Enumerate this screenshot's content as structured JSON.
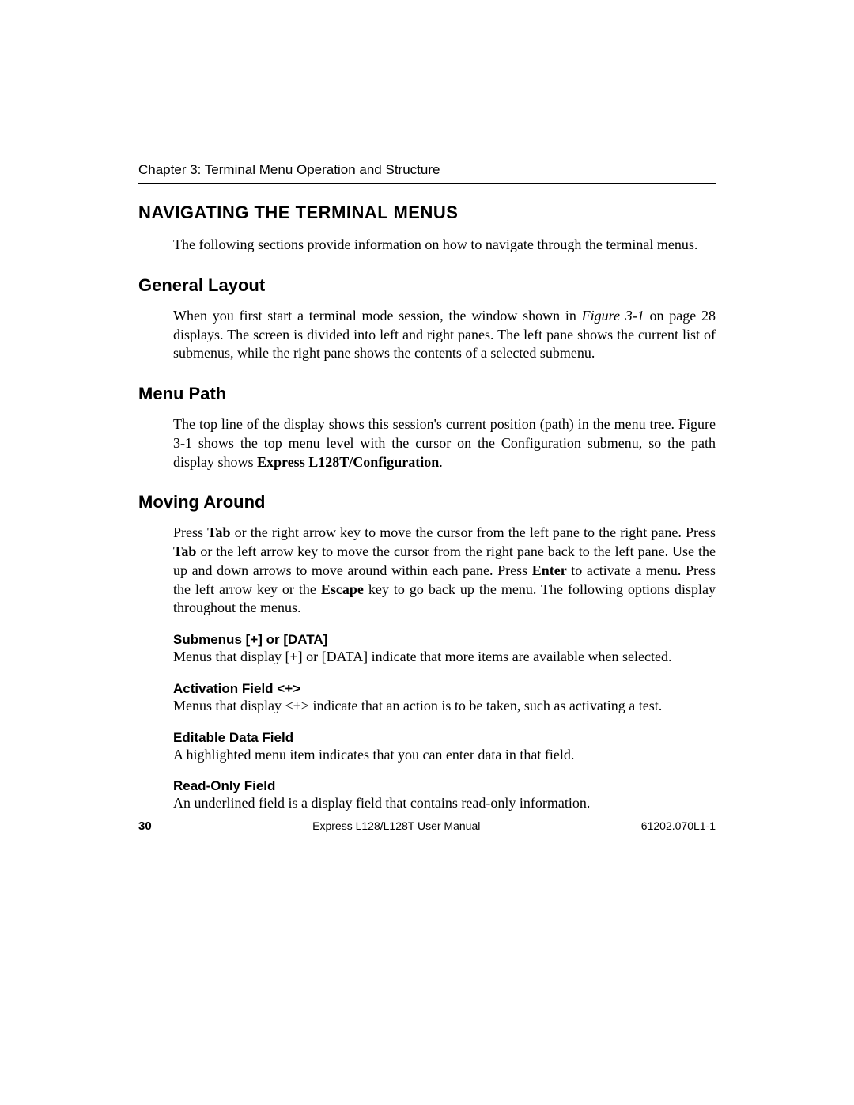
{
  "header": {
    "chapter": "Chapter 3: Terminal Menu Operation and Structure"
  },
  "title": "NAVIGATING THE TERMINAL MENUS",
  "intro": "The following sections provide information on how to navigate through the terminal menus.",
  "sections": {
    "general_layout": {
      "heading": "General Layout",
      "pre": "When you first start a terminal mode session, the window shown in ",
      "figref": "Figure 3-1",
      "post": " on page 28 displays. The screen is divided into left and right panes.  The left pane shows the current list of submenus, while the right pane shows the contents of a selected submenu."
    },
    "menu_path": {
      "heading": "Menu Path",
      "pre": "The top line of the display shows this session's current position (path) in the menu tree.  Figure 3-1 shows the top menu level with the cursor on the Configuration submenu, so the path display shows ",
      "bold": "Express L128T/Configuration",
      "post": "."
    },
    "moving_around": {
      "heading": "Moving Around",
      "p1a": "Press ",
      "tab1": "Tab",
      "p1b": " or the right arrow key to move the cursor from the left pane to the right pane.  Press ",
      "tab2": "Tab",
      "p1c": " or the left arrow key to move the cursor from the right pane back to the left pane. Use the up and down arrows to move around within each pane. Press ",
      "enter": "Enter",
      "p1d": " to activate a menu. Press the left arrow key or the ",
      "escape": "Escape",
      "p1e": " key to go back up the menu. The following options display throughout the menus.",
      "subs": {
        "submenus": {
          "heading": "Submenus [+] or [DATA]",
          "text": "Menus that display [+] or [DATA] indicate that more items are available when selected."
        },
        "activation": {
          "heading": "Activation Field <+>",
          "text": "Menus that display <+> indicate that an action is to be taken, such as activating a test."
        },
        "editable": {
          "heading": "Editable Data Field",
          "text": "A highlighted menu item indicates that you can enter data in that field."
        },
        "readonly": {
          "heading": "Read-Only Field",
          "text": "An underlined field is a display field that contains read-only information."
        }
      }
    }
  },
  "footer": {
    "page": "30",
    "center": "Express L128/L128T User Manual",
    "right": "61202.070L1-1"
  }
}
